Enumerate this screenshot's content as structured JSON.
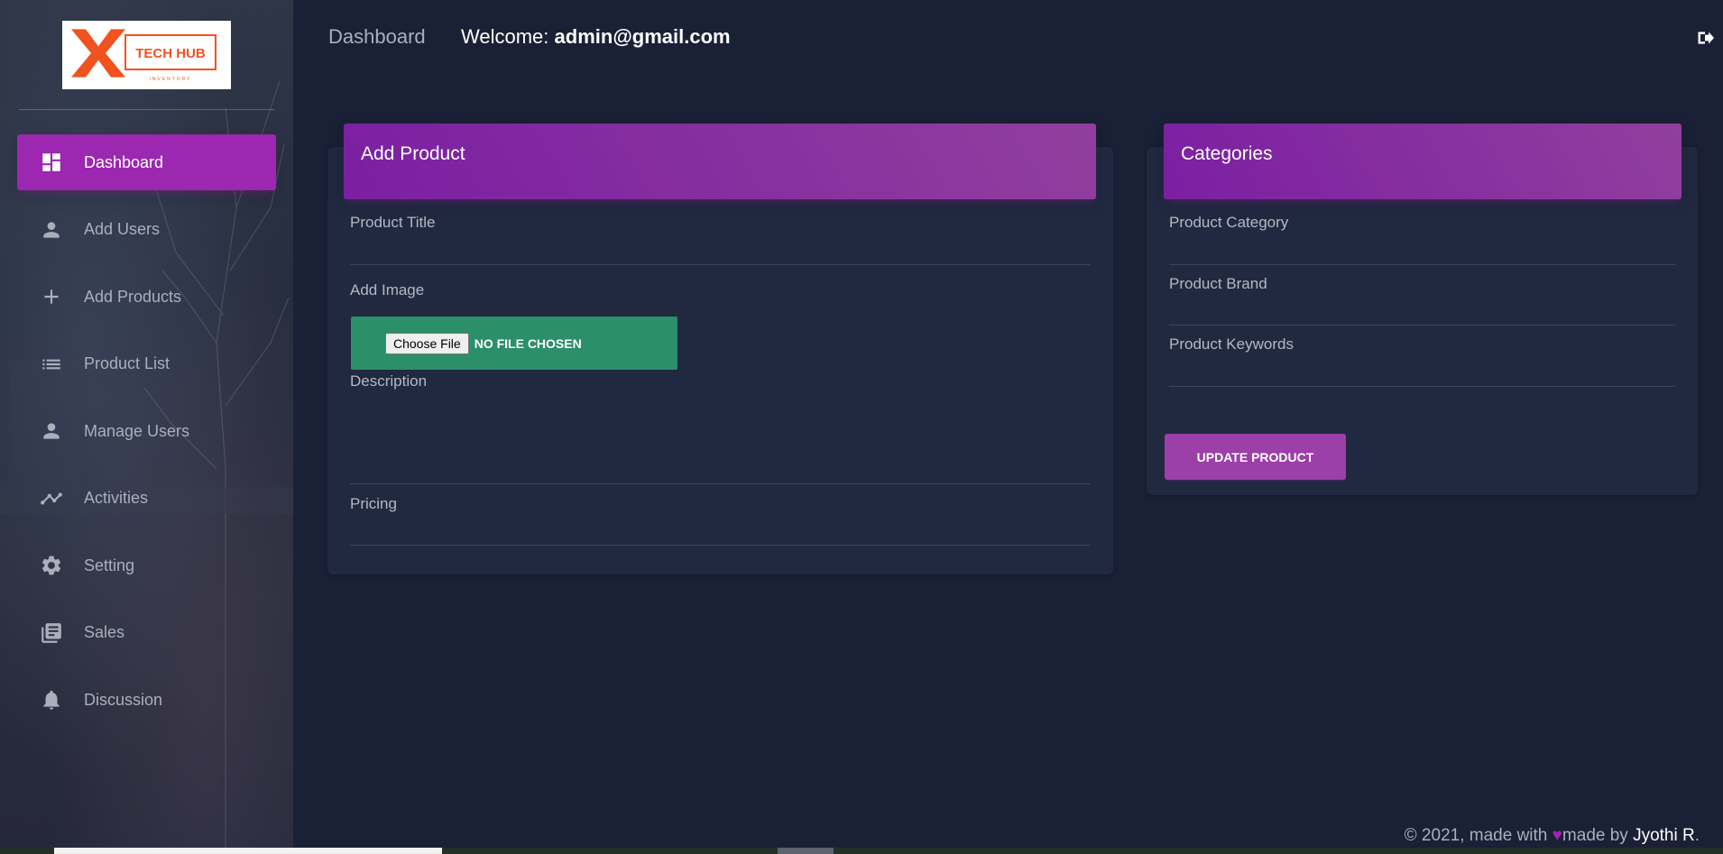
{
  "logo": {
    "title": "TECH HUB",
    "subtitle": "INVENTORY",
    "brand_color": "#f0531f"
  },
  "sidebar": {
    "items": [
      {
        "label": "Dashboard",
        "icon": "dashboard-icon",
        "active": true
      },
      {
        "label": "Add Users",
        "icon": "person-icon"
      },
      {
        "label": "Add Products",
        "icon": "plus-icon"
      },
      {
        "label": "Product List",
        "icon": "list-icon"
      },
      {
        "label": "Manage Users",
        "icon": "person-icon"
      },
      {
        "label": "Activities",
        "icon": "trending-icon"
      },
      {
        "label": "Setting",
        "icon": "gear-icon"
      },
      {
        "label": "Sales",
        "icon": "library-books-icon"
      },
      {
        "label": "Discussion",
        "icon": "bell-icon"
      }
    ]
  },
  "header": {
    "title": "Dashboard",
    "welcome_prefix": "Welcome:",
    "user_email": "admin@gmail.com"
  },
  "add_product": {
    "title": "Add Product",
    "product_title_label": "Product Title",
    "add_image_label": "Add Image",
    "choose_file_label": "Choose File",
    "file_status": "NO FILE CHOSEN",
    "description_label": "Description",
    "pricing_label": "Pricing"
  },
  "categories": {
    "title": "Categories",
    "category_label": "Product Category",
    "brand_label": "Product Brand",
    "keywords_label": "Product Keywords",
    "update_button": "UPDATE PRODUCT"
  },
  "footer": {
    "prefix": "© 2021, made with",
    "heart": "♥",
    "middle": "made by",
    "author": "Jyothi R",
    "suffix": "."
  },
  "colors": {
    "background": "#1a2035",
    "card": "#202940",
    "accent": "#9c27b0",
    "file_input": "#2b8f6b"
  }
}
